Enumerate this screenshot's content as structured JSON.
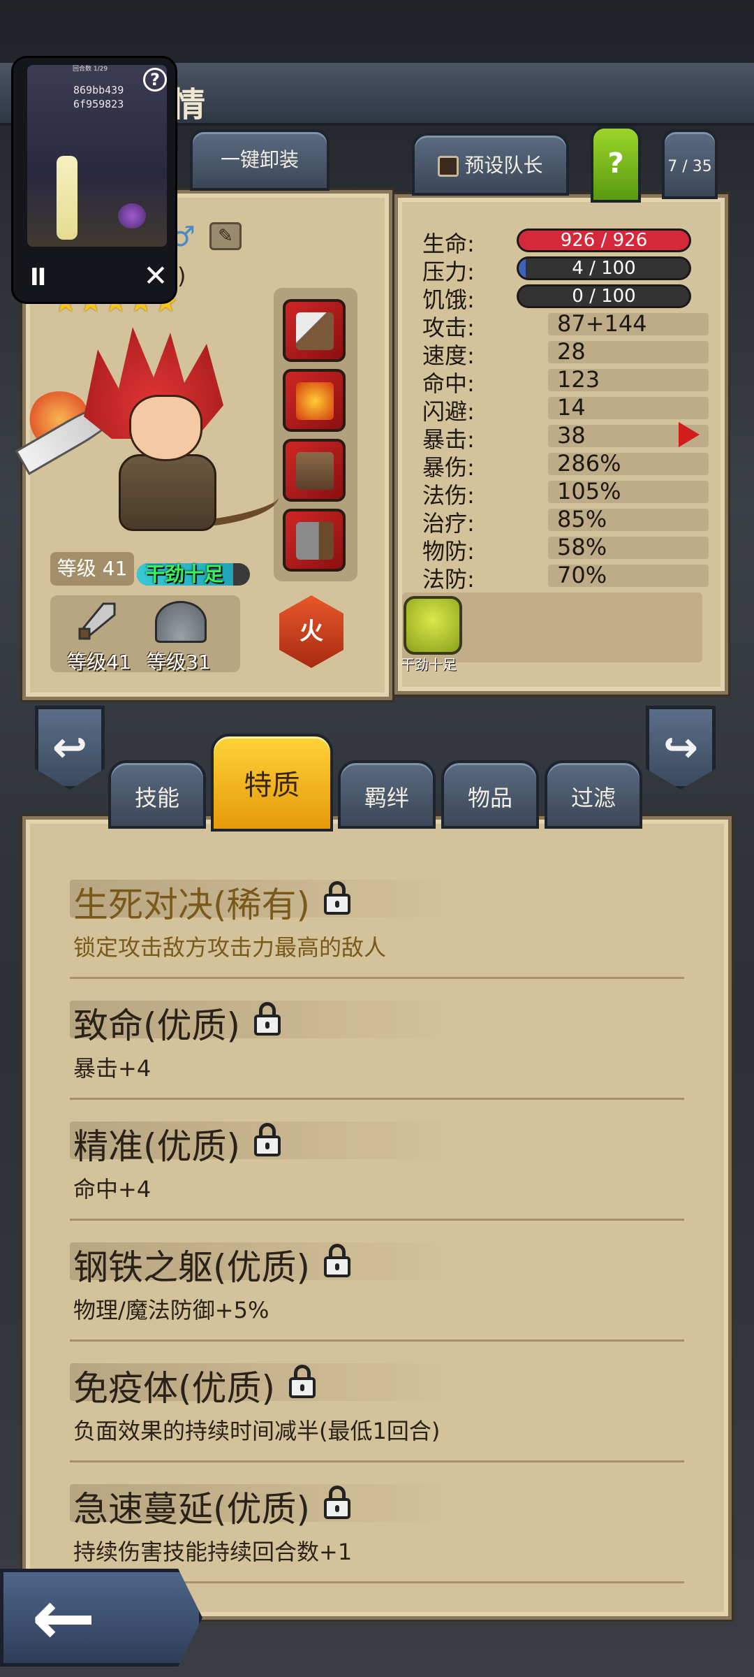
{
  "header": {
    "title_fragment": "情"
  },
  "mini_window": {
    "line1": "869bb439",
    "line2": "6f959823",
    "small_label": "回合数 1/29",
    "help_icon": "?",
    "pause_icon": "II",
    "close_icon": "✕"
  },
  "top_buttons": {
    "unequip_all": "一键卸装",
    "preset_captain": "预设队长",
    "help": "?",
    "team_count": "7 / 35"
  },
  "hero": {
    "name_fragment": "有)",
    "stars": 5,
    "level": "等级 41",
    "status": "干劲十足",
    "status_fill": 0.85,
    "weapon_level": "等级41",
    "armor_level": "等级31",
    "element": "火",
    "slot_icons": [
      "dagger-icon",
      "fire-staff-icon",
      "cloak-icon",
      "hammer-icon"
    ]
  },
  "stats": {
    "life": {
      "label": "生命:",
      "value": "926 / 926",
      "fill": 1.0,
      "color": "#d5283a"
    },
    "stress": {
      "label": "压力:",
      "value": "4 / 100",
      "fill": 0.04,
      "color": "#3f61b8"
    },
    "hunger": {
      "label": "饥饿:",
      "value": "0 / 100",
      "fill": 0.0,
      "color": "#c2a030"
    },
    "rows": [
      {
        "label": "攻击:",
        "value": "87+144"
      },
      {
        "label": "速度:",
        "value": "28"
      },
      {
        "label": "命中:",
        "value": "123"
      },
      {
        "label": "闪避:",
        "value": "14"
      },
      {
        "label": "暴击:",
        "value": "38"
      },
      {
        "label": "暴伤:",
        "value": "286%"
      },
      {
        "label": "法伤:",
        "value": "105%"
      },
      {
        "label": "治疗:",
        "value": "85%"
      },
      {
        "label": "物防:",
        "value": "58%"
      },
      {
        "label": "法防:",
        "value": "70%"
      }
    ]
  },
  "buff": {
    "label": "干劲十足"
  },
  "tabs": [
    {
      "label": "技能",
      "active": false
    },
    {
      "label": "特质",
      "active": true
    },
    {
      "label": "羁绊",
      "active": false
    },
    {
      "label": "物品",
      "active": false
    },
    {
      "label": "过滤",
      "active": false
    }
  ],
  "traits": [
    {
      "title": "生死对决(稀有)",
      "desc": "锁定攻击敌方攻击力最高的敌人",
      "rare": true
    },
    {
      "title": "致命(优质)",
      "desc": "暴击+4",
      "rare": false
    },
    {
      "title": "精准(优质)",
      "desc": "命中+4",
      "rare": false
    },
    {
      "title": "钢铁之躯(优质)",
      "desc": "物理/魔法防御+5%",
      "rare": false
    },
    {
      "title": "免疫体(优质)",
      "desc": "负面效果的持续时间减半(最低1回合)",
      "rare": false
    },
    {
      "title": "急速蔓延(优质)",
      "desc": "持续伤害技能持续回合数+1",
      "rare": false
    }
  ],
  "nav": {
    "prev_icon": "↩",
    "next_icon": "↪",
    "back_icon": "←"
  }
}
